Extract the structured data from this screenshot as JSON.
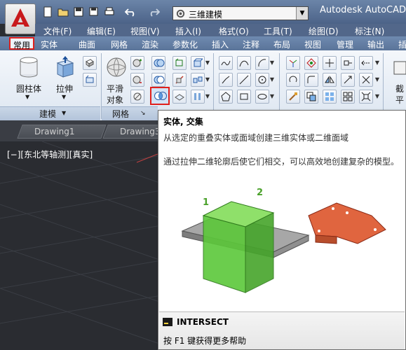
{
  "app": {
    "title": "Autodesk AutoCAD 2",
    "workspace": "三维建模",
    "logo_letter": "A"
  },
  "quick_access": [
    "new-icon",
    "open-icon",
    "save-icon",
    "saveas-icon",
    "print-icon",
    "undo-icon",
    "redo-icon"
  ],
  "menubar": [
    "文件(F)",
    "编辑(E)",
    "视图(V)",
    "插入(I)",
    "格式(O)",
    "工具(T)",
    "绘图(D)",
    "标注(N)"
  ],
  "tabs": {
    "active": "常用",
    "others": [
      "实体",
      "曲面",
      "网格",
      "渲染",
      "参数化",
      "插入",
      "注释",
      "布局",
      "视图",
      "管理",
      "输出",
      "插"
    ]
  },
  "ribbon": {
    "cylinder_label": "圆柱体",
    "extrude_label": "拉伸",
    "smooth_label_1": "平滑",
    "smooth_label_2": "对象",
    "modeling_panel": "建模",
    "mesh_panel": "网格",
    "section_label_1": "截",
    "section_label_2": "平"
  },
  "file_tabs": [
    "Drawing1",
    "Drawing3"
  ],
  "viewport_label": "[−][东北等轴测][真实]",
  "tooltip": {
    "title": "实体, 交集",
    "description": "从选定的重叠实体或面域创建三维实体或二维面域",
    "detail": "通过拉伸二维轮廓后使它们相交，可以高效地创建复杂的模型。",
    "label_1": "1",
    "label_2": "2",
    "command": "INTERSECT",
    "help": "按 F1 键获得更多帮助"
  },
  "colors": {
    "accent_highlight": "#e0201c",
    "solid_green": "#5cc83a",
    "result_orange": "#e0653f",
    "title_blue": "#4c6388"
  }
}
